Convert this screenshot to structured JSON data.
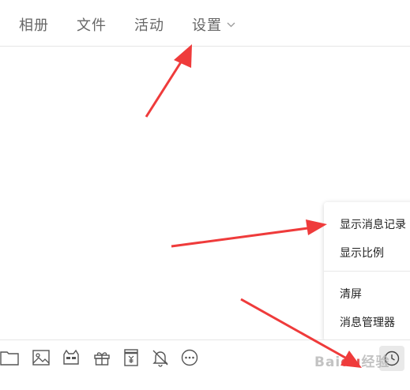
{
  "tabs": [
    {
      "label": "相册"
    },
    {
      "label": "文件"
    },
    {
      "label": "活动"
    },
    {
      "label": "设置"
    }
  ],
  "context_menu": {
    "items": [
      {
        "label": "显示消息记录"
      },
      {
        "label": "显示比例"
      },
      {
        "label": "清屏"
      },
      {
        "label": "消息管理器"
      }
    ]
  },
  "toolbar": {
    "icons": [
      "folder-icon",
      "image-icon",
      "emoji-cat-icon",
      "gift-icon",
      "red-envelope-icon",
      "bell-off-icon",
      "more-icon"
    ],
    "history_icon": "clock-icon"
  },
  "watermark": {
    "text": "Bai",
    "brand": "du",
    "suffix": "经验"
  },
  "colors": {
    "arrow": "#ef3b3b",
    "divider": "#e6e6e6",
    "tab_text": "#666666"
  }
}
